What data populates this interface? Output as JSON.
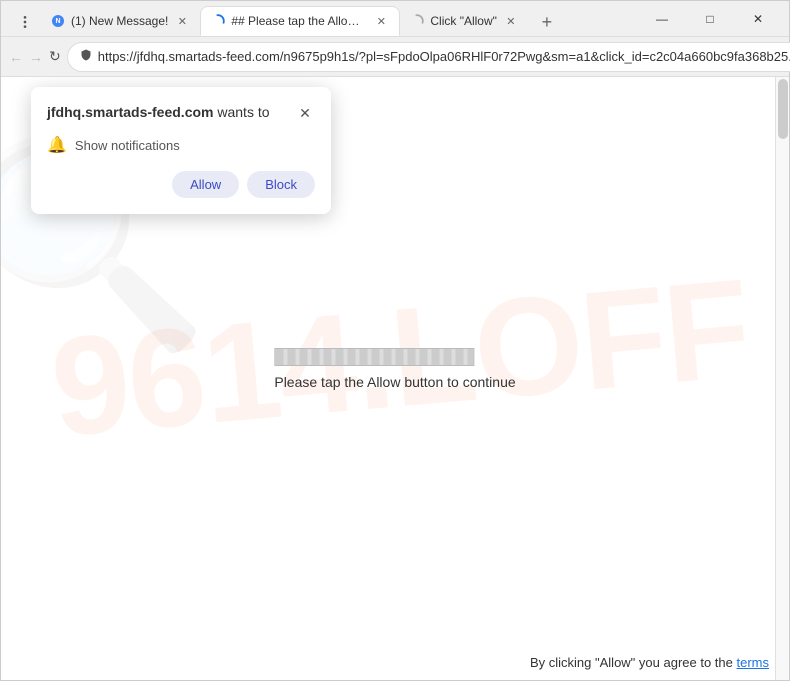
{
  "browser": {
    "tabs": [
      {
        "id": "tab1",
        "label": "(1) New Message!",
        "favicon_type": "notification",
        "active": false,
        "closeable": true
      },
      {
        "id": "tab2",
        "label": "## Please tap the Allow button...",
        "favicon_type": "loading",
        "active": true,
        "closeable": true
      },
      {
        "id": "tab3",
        "label": "Click \"Allow\"",
        "favicon_type": "loading",
        "active": false,
        "closeable": true
      }
    ],
    "new_tab_label": "+",
    "url": "https://jfdhq.smartads-feed.com/n9675p9h1s/?pl=sFpdoOlpa06RHlF0r72Pwg&sm=a1&click_id=c2c04a660bc9fa368b25...",
    "nav": {
      "back": "←",
      "forward": "→",
      "refresh": "↻"
    },
    "window_controls": {
      "minimize": "—",
      "maximize": "□",
      "close": "✕"
    }
  },
  "popup": {
    "domain": "jfdhq.smartads-feed.com",
    "wants_to": "wants to",
    "permission": "Show notifications",
    "allow_label": "Allow",
    "block_label": "Block",
    "close_icon": "✕"
  },
  "page": {
    "loading_text": "Please tap the Allow button to continue",
    "footer": "By clicking \"Allow\" you agree to the",
    "footer_link": "terms",
    "watermark": "9614.LOFF"
  }
}
